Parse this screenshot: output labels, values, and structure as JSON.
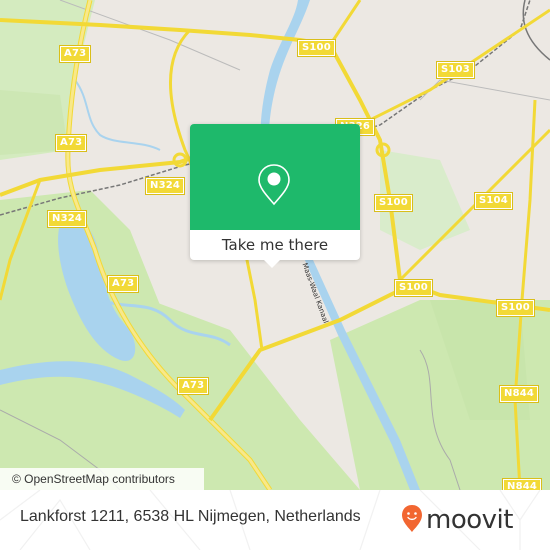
{
  "map": {
    "attribution": "© OpenStreetMap contributors",
    "road_badges": [
      {
        "label": "A73"
      },
      {
        "label": "A73"
      },
      {
        "label": "A73"
      },
      {
        "label": "A73"
      },
      {
        "label": "N324"
      },
      {
        "label": "N324"
      },
      {
        "label": "S100"
      },
      {
        "label": "S100"
      },
      {
        "label": "S100"
      },
      {
        "label": "S100"
      },
      {
        "label": "S103"
      },
      {
        "label": "S104"
      },
      {
        "label": "N326"
      },
      {
        "label": "N844"
      },
      {
        "label": "N844"
      }
    ],
    "waterway_label": "Maas-Waal Kanaal",
    "colors": {
      "urban": "#ece8e3",
      "green": "#cde8b0",
      "water": "#a9d3ee",
      "road": "#f6e07a"
    }
  },
  "popup": {
    "icon": "map-pin-icon",
    "button_label": "Take me there",
    "color": "#1eb96b"
  },
  "footer": {
    "address": "Lankforst 1211, 6538 HL Nijmegen, Netherlands",
    "brand": "moovit",
    "brand_icon": "moovit-smiley-pin-icon",
    "brand_color": "#f26631"
  }
}
